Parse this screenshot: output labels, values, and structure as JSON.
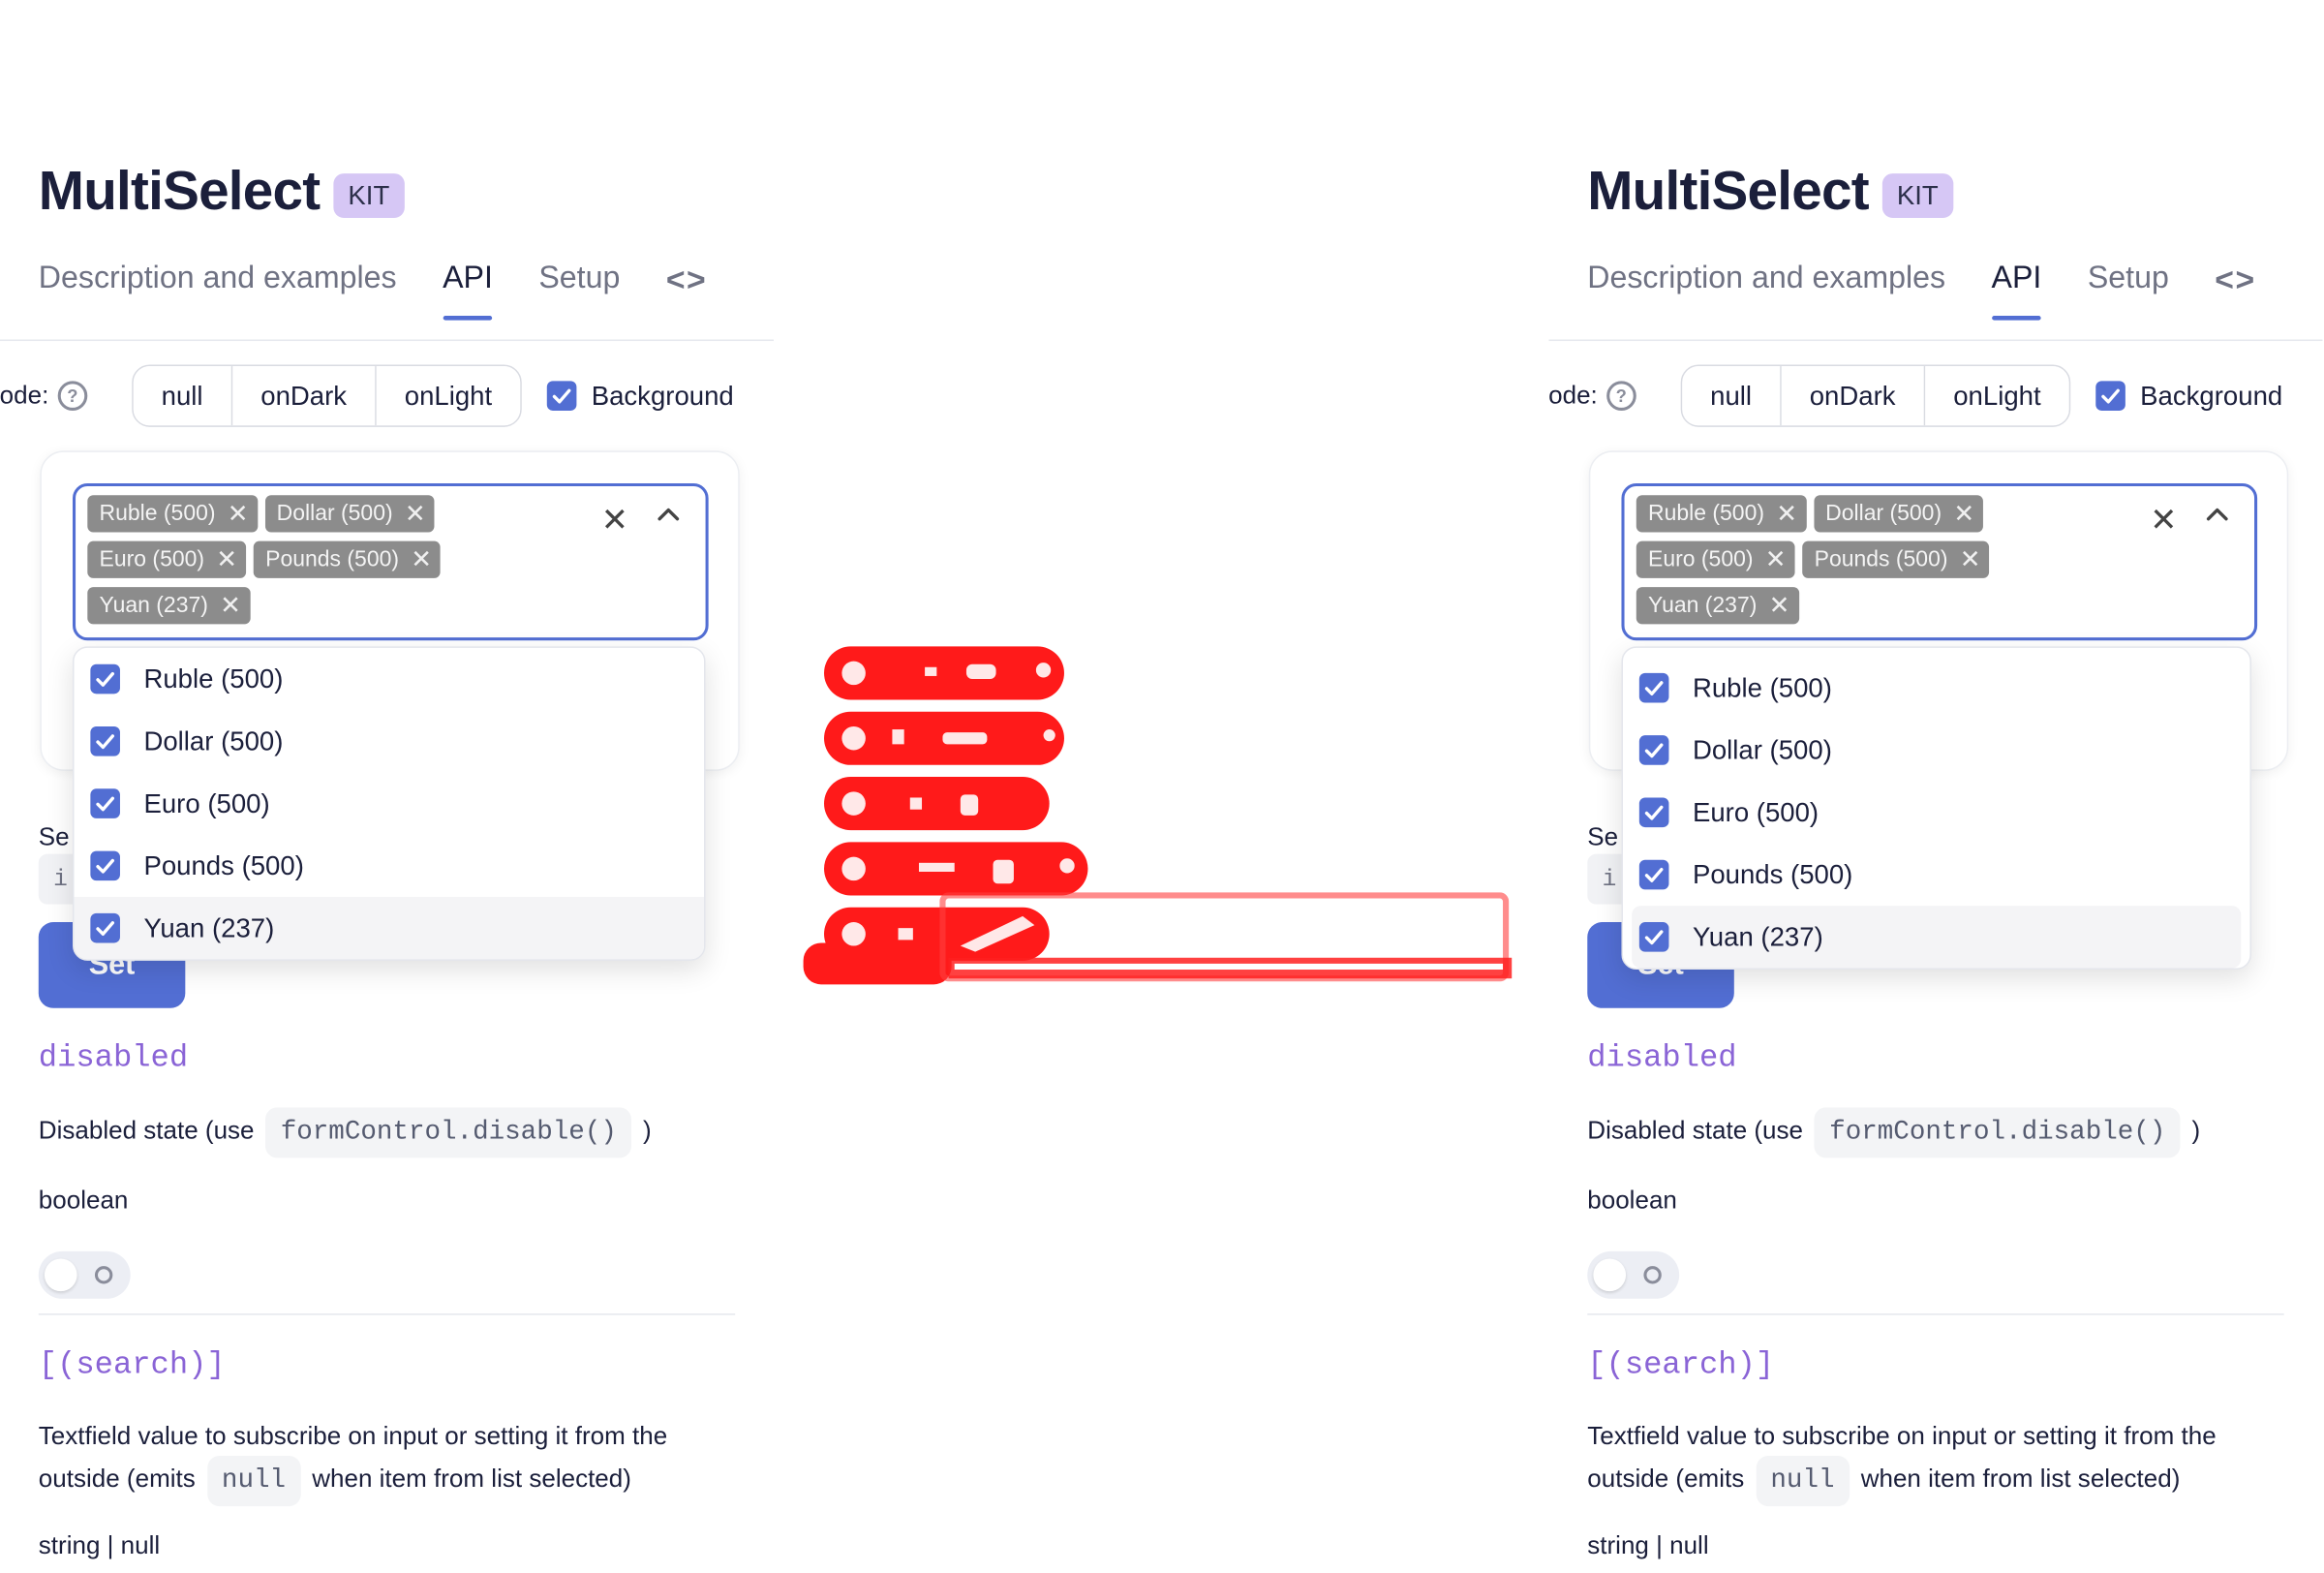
{
  "panels": [
    {
      "id": "before",
      "title": "MultiSelect",
      "badge": "KIT",
      "tabs": [
        "Description and examples",
        "API",
        "Setup"
      ],
      "tab_code_icon": "code-brackets-icon",
      "mode": {
        "label": "lode:",
        "options": [
          "null",
          "onDark",
          "onLight"
        ],
        "background_label": "Background",
        "background_checked": true
      },
      "selected_chips": [
        "Ruble (500)",
        "Dollar (500)",
        "Euro (500)",
        "Pounds (500)",
        "Yuan (237)"
      ],
      "dropdown_options": [
        "Ruble (500)",
        "Dollar (500)",
        "Euro (500)",
        "Pounds (500)",
        "Yuan (237)"
      ],
      "set_label": "Se",
      "set_input": "i",
      "set_button": "Set",
      "disabled": {
        "name": "disabled",
        "desc_prefix": "Disabled state (use",
        "desc_code": "formControl.disable()",
        "desc_suffix": ")",
        "type": "boolean"
      },
      "search": {
        "name": "[(search)]",
        "desc_line1": "Textfield value to subscribe on input or setting it from the",
        "desc_line2_prefix": "outside (emits",
        "desc_code": "null",
        "desc_line2_suffix": "when item from list selected)",
        "type": "string | null"
      }
    },
    {
      "id": "after",
      "title": "MultiSelect",
      "badge": "KIT",
      "tabs": [
        "Description and examples",
        "API",
        "Setup"
      ],
      "tab_code_icon": "code-brackets-icon",
      "mode": {
        "label": "lode:",
        "options": [
          "null",
          "onDark",
          "onLight"
        ],
        "background_label": "Background",
        "background_checked": true
      },
      "selected_chips": [
        "Ruble (500)",
        "Dollar (500)",
        "Euro (500)",
        "Pounds (500)",
        "Yuan (237)"
      ],
      "dropdown_options": [
        "Ruble (500)",
        "Dollar (500)",
        "Euro (500)",
        "Pounds (500)",
        "Yuan (237)"
      ],
      "set_label": "Se",
      "set_input": "i",
      "set_button": "Set",
      "disabled": {
        "name": "disabled",
        "desc_prefix": "Disabled state (use",
        "desc_code": "formControl.disable()",
        "desc_suffix": ")",
        "type": "boolean"
      },
      "search": {
        "name": "[(search)]",
        "desc_line1": "Textfield value to subscribe on input or setting it from the",
        "desc_line2_prefix": "outside (emits",
        "desc_code": "null",
        "desc_line2_suffix": "when item from list selected)",
        "type": "string | null"
      }
    }
  ],
  "colors": {
    "accent": "#526ed3",
    "chip": "#8c8c8c",
    "badge": "#d6c7f5",
    "prop_name": "#8a64d6",
    "diff": "#ff0000"
  }
}
